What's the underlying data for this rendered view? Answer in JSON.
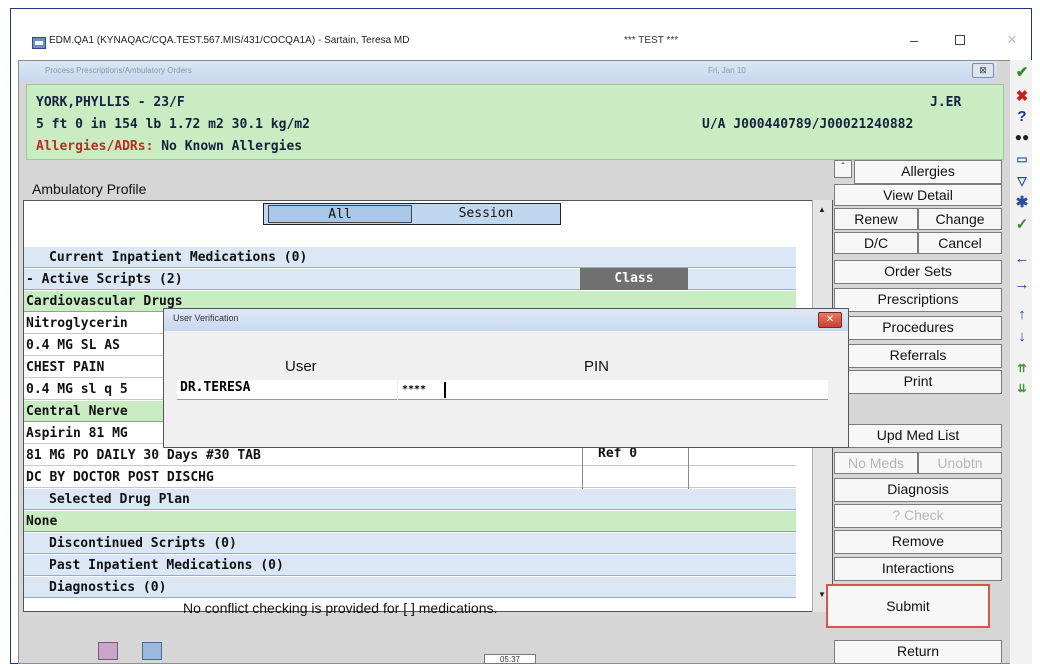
{
  "window": {
    "title": "EDM.QA1 (KYNAQAC/CQA.TEST.567.MIS/431/COCQA1A) - Sartain, Teresa MD",
    "test_label": "*** TEST ***",
    "minimize": "–",
    "close": "✕"
  },
  "inner": {
    "title": "Process Prescriptions/Ambulatory Orders",
    "date": "Fri, Jan 10",
    "close": "⊠"
  },
  "patient": {
    "name_line": "YORK,PHYLLIS - 23/F",
    "location": "J.ER",
    "vitals": "5 ft 0 in 154 lb  1.72 m2  30.1 kg/m2",
    "account": "U/A J000440789/J00021240882",
    "allergies_label": "Allergies/ADRs:",
    "allergies_value": "No Known Allergies"
  },
  "profile": {
    "label": "Ambulatory Profile",
    "filters": {
      "all": "All",
      "session": "Session"
    },
    "class_header": "Class",
    "ref_label": "Ref 0",
    "rows": [
      "Current Inpatient Medications (0)",
      "- Active Scripts (2)",
      "Cardiovascular Drugs",
      "Nitroglycerin",
      "0.4 MG SL AS",
      "CHEST PAIN",
      "0.4 MG sl q 5",
      "Central Nerve",
      "Aspirin 81 MG",
      "81 MG PO DAILY 30 Days #30 TAB",
      "DC BY DOCTOR POST DISCHG",
      "Selected Drug Plan",
      "None",
      "Discontinued Scripts (0)",
      "Past Inpatient Medications (0)",
      "Diagnostics (0)"
    ],
    "conflict_text": "No conflict checking is provided for [ ] medications."
  },
  "buttons": {
    "allergies": "Allergies",
    "view_detail": "View Detail",
    "renew": "Renew",
    "change": "Change",
    "dc": "D/C",
    "cancel": "Cancel",
    "order_sets": "Order Sets",
    "prescriptions": "Prescriptions",
    "procedures": "Procedures",
    "referrals": "Referrals",
    "print": "Print",
    "upd_med_list": "Upd Med List",
    "no_meds": "No Meds",
    "unobtn": "Unobtn",
    "diagnosis": "Diagnosis",
    "check": "? Check",
    "remove": "Remove",
    "interactions": "Interactions",
    "submit": "Submit",
    "return": "Return"
  },
  "dialog": {
    "title": "User Verification",
    "user_label": "User",
    "pin_label": "PIN",
    "user_value": "DR.TERESA",
    "pin_value": "****"
  },
  "bottom_badge": "05:37",
  "toolbar_icons": [
    "check-icon",
    "x-icon",
    "question-icon",
    "binoculars-icon",
    "monitor-icon",
    "filter-icon",
    "asterisk-icon",
    "checkmark-icon",
    "arrow-left-icon",
    "arrow-right-icon",
    "arrow-up-icon",
    "arrow-down-icon",
    "double-up-icon",
    "double-down-icon"
  ],
  "colors": {
    "patient_header_bg": "#c9ecc2",
    "section_row_bg": "#dbe7f4",
    "green_row_bg": "#c9ecc2",
    "allergy_label": "#b3321d",
    "submit_highlight": "#d9534f"
  }
}
